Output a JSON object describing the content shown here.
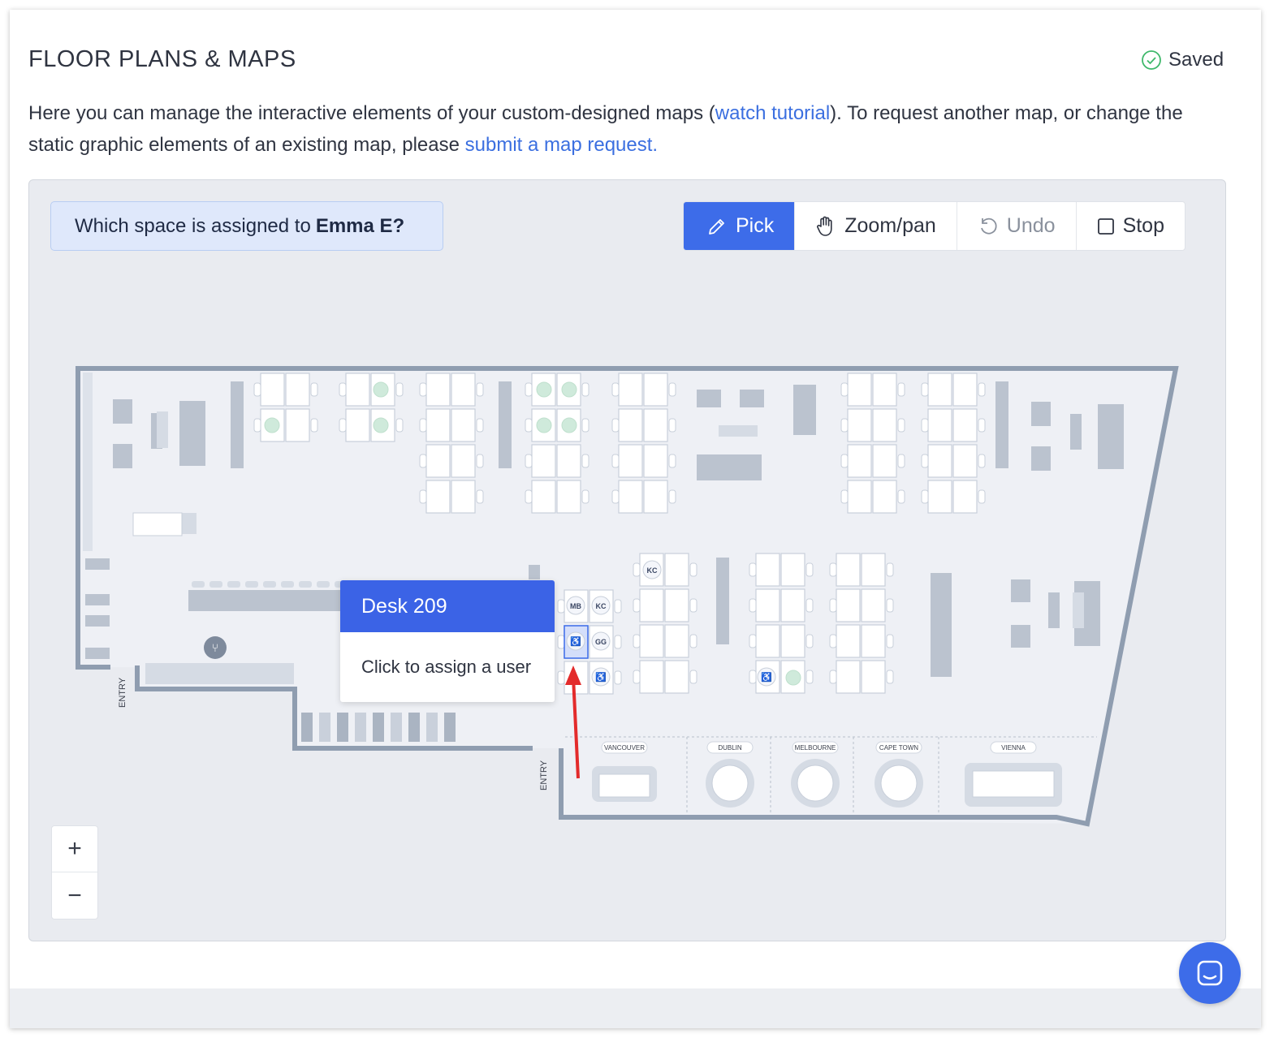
{
  "header": {
    "title": "FLOOR PLANS & MAPS",
    "saved_label": "Saved"
  },
  "description": {
    "part1": "Here you can manage the interactive elements of your custom-designed maps (",
    "link1": "watch tutorial",
    "part2": "). To request another map, or change the static graphic elements of an existing map, please ",
    "link2": "submit a map request."
  },
  "question": {
    "prefix": "Which space is assigned to",
    "name": "Emma E?"
  },
  "toolbar": {
    "pick_label": "Pick",
    "zoom_label": "Zoom/pan",
    "undo_label": "Undo",
    "stop_label": "Stop"
  },
  "map": {
    "entry_label": "ENTRY",
    "rooms": [
      "VANCOUVER",
      "DUBLIN",
      "MELBOURNE",
      "CAPE TOWN",
      "VIENNA"
    ],
    "desk_initials": [
      "MB",
      "KC",
      "GG",
      "KC"
    ]
  },
  "popup": {
    "title": "Desk 209",
    "body": "Click to assign a user"
  },
  "zoom": {
    "plus": "+",
    "minus": "−"
  },
  "colors": {
    "accent": "#3d6ce9",
    "link": "#3b6fe0",
    "wall": "#8f9db0",
    "arrow": "#e32b2b"
  }
}
